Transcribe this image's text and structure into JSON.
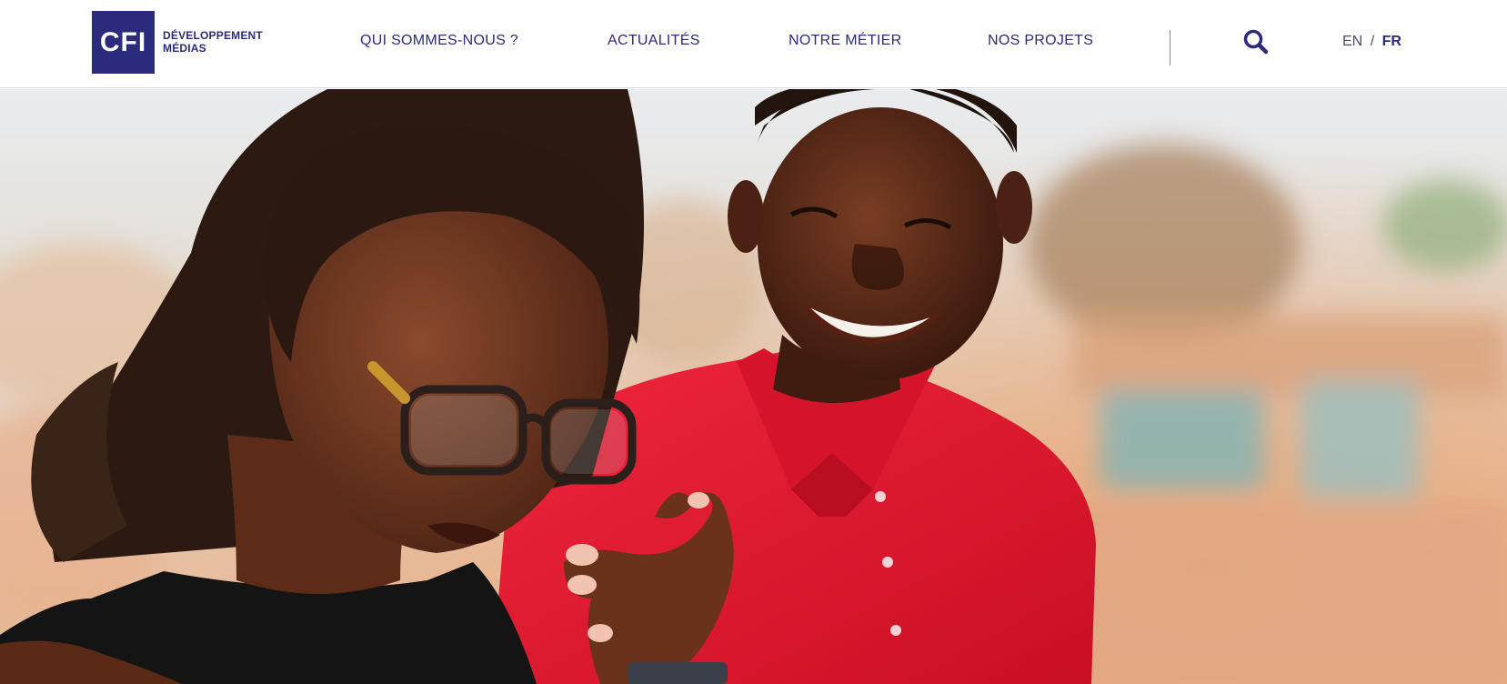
{
  "brand": {
    "logo_mark": "CFI",
    "tagline_line1": "DÉVELOPPEMENT",
    "tagline_line2": "MÉDIAS",
    "color": "#2c2a7c"
  },
  "nav": {
    "items": [
      {
        "label": "QUI SOMMES-NOUS ?"
      },
      {
        "label": "ACTUALITÉS"
      },
      {
        "label": "NOTRE MÉTIER"
      },
      {
        "label": "NOS PROJETS"
      }
    ]
  },
  "search": {
    "icon": "search-icon"
  },
  "language": {
    "en": "EN",
    "separator": "/",
    "fr": "FR",
    "active": "FR"
  },
  "hero": {
    "image": "photo of a woman with glasses and a smiling man in a red polo shirt looking down"
  }
}
